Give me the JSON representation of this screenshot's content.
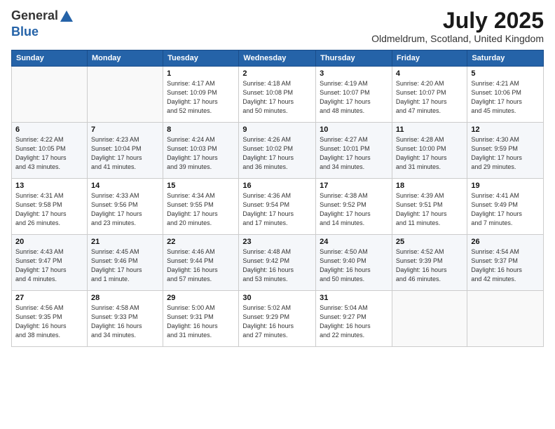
{
  "header": {
    "title": "July 2025",
    "location": "Oldmeldrum, Scotland, United Kingdom"
  },
  "columns": [
    "Sunday",
    "Monday",
    "Tuesday",
    "Wednesday",
    "Thursday",
    "Friday",
    "Saturday"
  ],
  "weeks": [
    [
      {
        "day": "",
        "info": ""
      },
      {
        "day": "",
        "info": ""
      },
      {
        "day": "1",
        "info": "Sunrise: 4:17 AM\nSunset: 10:09 PM\nDaylight: 17 hours\nand 52 minutes."
      },
      {
        "day": "2",
        "info": "Sunrise: 4:18 AM\nSunset: 10:08 PM\nDaylight: 17 hours\nand 50 minutes."
      },
      {
        "day": "3",
        "info": "Sunrise: 4:19 AM\nSunset: 10:07 PM\nDaylight: 17 hours\nand 48 minutes."
      },
      {
        "day": "4",
        "info": "Sunrise: 4:20 AM\nSunset: 10:07 PM\nDaylight: 17 hours\nand 47 minutes."
      },
      {
        "day": "5",
        "info": "Sunrise: 4:21 AM\nSunset: 10:06 PM\nDaylight: 17 hours\nand 45 minutes."
      }
    ],
    [
      {
        "day": "6",
        "info": "Sunrise: 4:22 AM\nSunset: 10:05 PM\nDaylight: 17 hours\nand 43 minutes."
      },
      {
        "day": "7",
        "info": "Sunrise: 4:23 AM\nSunset: 10:04 PM\nDaylight: 17 hours\nand 41 minutes."
      },
      {
        "day": "8",
        "info": "Sunrise: 4:24 AM\nSunset: 10:03 PM\nDaylight: 17 hours\nand 39 minutes."
      },
      {
        "day": "9",
        "info": "Sunrise: 4:26 AM\nSunset: 10:02 PM\nDaylight: 17 hours\nand 36 minutes."
      },
      {
        "day": "10",
        "info": "Sunrise: 4:27 AM\nSunset: 10:01 PM\nDaylight: 17 hours\nand 34 minutes."
      },
      {
        "day": "11",
        "info": "Sunrise: 4:28 AM\nSunset: 10:00 PM\nDaylight: 17 hours\nand 31 minutes."
      },
      {
        "day": "12",
        "info": "Sunrise: 4:30 AM\nSunset: 9:59 PM\nDaylight: 17 hours\nand 29 minutes."
      }
    ],
    [
      {
        "day": "13",
        "info": "Sunrise: 4:31 AM\nSunset: 9:58 PM\nDaylight: 17 hours\nand 26 minutes."
      },
      {
        "day": "14",
        "info": "Sunrise: 4:33 AM\nSunset: 9:56 PM\nDaylight: 17 hours\nand 23 minutes."
      },
      {
        "day": "15",
        "info": "Sunrise: 4:34 AM\nSunset: 9:55 PM\nDaylight: 17 hours\nand 20 minutes."
      },
      {
        "day": "16",
        "info": "Sunrise: 4:36 AM\nSunset: 9:54 PM\nDaylight: 17 hours\nand 17 minutes."
      },
      {
        "day": "17",
        "info": "Sunrise: 4:38 AM\nSunset: 9:52 PM\nDaylight: 17 hours\nand 14 minutes."
      },
      {
        "day": "18",
        "info": "Sunrise: 4:39 AM\nSunset: 9:51 PM\nDaylight: 17 hours\nand 11 minutes."
      },
      {
        "day": "19",
        "info": "Sunrise: 4:41 AM\nSunset: 9:49 PM\nDaylight: 17 hours\nand 7 minutes."
      }
    ],
    [
      {
        "day": "20",
        "info": "Sunrise: 4:43 AM\nSunset: 9:47 PM\nDaylight: 17 hours\nand 4 minutes."
      },
      {
        "day": "21",
        "info": "Sunrise: 4:45 AM\nSunset: 9:46 PM\nDaylight: 17 hours\nand 1 minute."
      },
      {
        "day": "22",
        "info": "Sunrise: 4:46 AM\nSunset: 9:44 PM\nDaylight: 16 hours\nand 57 minutes."
      },
      {
        "day": "23",
        "info": "Sunrise: 4:48 AM\nSunset: 9:42 PM\nDaylight: 16 hours\nand 53 minutes."
      },
      {
        "day": "24",
        "info": "Sunrise: 4:50 AM\nSunset: 9:40 PM\nDaylight: 16 hours\nand 50 minutes."
      },
      {
        "day": "25",
        "info": "Sunrise: 4:52 AM\nSunset: 9:39 PM\nDaylight: 16 hours\nand 46 minutes."
      },
      {
        "day": "26",
        "info": "Sunrise: 4:54 AM\nSunset: 9:37 PM\nDaylight: 16 hours\nand 42 minutes."
      }
    ],
    [
      {
        "day": "27",
        "info": "Sunrise: 4:56 AM\nSunset: 9:35 PM\nDaylight: 16 hours\nand 38 minutes."
      },
      {
        "day": "28",
        "info": "Sunrise: 4:58 AM\nSunset: 9:33 PM\nDaylight: 16 hours\nand 34 minutes."
      },
      {
        "day": "29",
        "info": "Sunrise: 5:00 AM\nSunset: 9:31 PM\nDaylight: 16 hours\nand 31 minutes."
      },
      {
        "day": "30",
        "info": "Sunrise: 5:02 AM\nSunset: 9:29 PM\nDaylight: 16 hours\nand 27 minutes."
      },
      {
        "day": "31",
        "info": "Sunrise: 5:04 AM\nSunset: 9:27 PM\nDaylight: 16 hours\nand 22 minutes."
      },
      {
        "day": "",
        "info": ""
      },
      {
        "day": "",
        "info": ""
      }
    ]
  ]
}
